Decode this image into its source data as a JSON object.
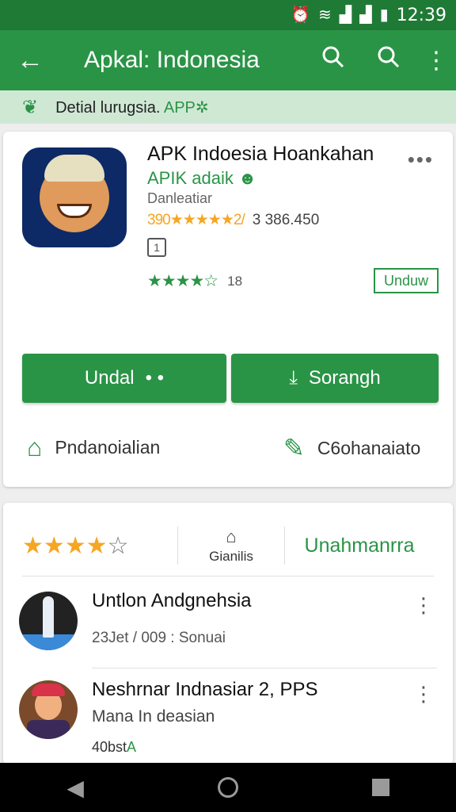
{
  "status_bar": {
    "time": "12:39"
  },
  "app_bar": {
    "title": "Apkal: Indonesia"
  },
  "subheader": {
    "text": "Detial lurugsia.",
    "highlight": "APP"
  },
  "app": {
    "name": "APK Indoesia Hoankahan",
    "developer": "APIK adaik",
    "category": "Danleatiar",
    "rating_text": "390",
    "rating_stars": "★★★★★",
    "rating_suffix": "2/",
    "downloads": "3 386.450",
    "rating2_stars": "★★★★☆",
    "rating2_count": "18",
    "unduh_label": "Unduw"
  },
  "buttons": {
    "left_label": "Undal",
    "left_dots": "• •",
    "right_label": "Sorangh"
  },
  "links": {
    "left_label": "Pndanoialian",
    "right_label": "C6ohanaiato"
  },
  "rating_section": {
    "mid_label": "Gianilis",
    "right_label": "Unahmanrra"
  },
  "list": [
    {
      "title": "Untlon Andgnehsia",
      "subtitle": "23Jet / 009 : Sonuai"
    },
    {
      "title": "Neshrnar Indnasiar 2, PPS",
      "subtitle": "Mana In deasian",
      "extra": "40bst",
      "extra_highlight": "A"
    }
  ],
  "colors": {
    "primary": "#2a9446",
    "status": "#1f7a35",
    "star": "#f5a623"
  }
}
